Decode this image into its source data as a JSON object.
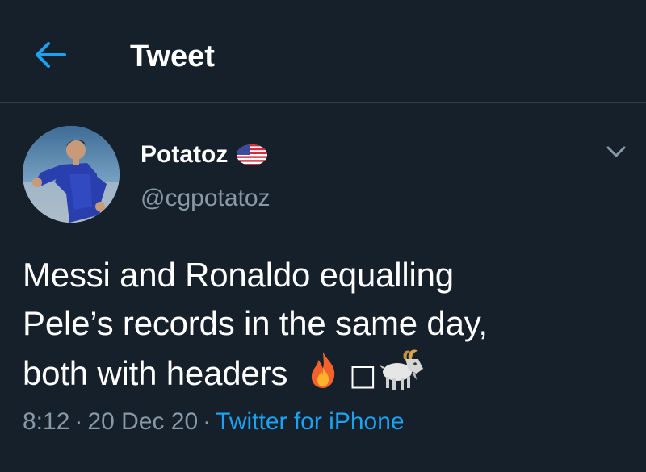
{
  "header": {
    "title": "Tweet",
    "back_icon": "arrow-left-icon",
    "accent_color": "#1da1f2"
  },
  "author": {
    "display_name": "Potatoz",
    "flag_icon": "us-flag-icon",
    "handle": "@cgpotatoz",
    "avatar_icon": "avatar-photo"
  },
  "tweet": {
    "lines": [
      "Messi and Ronaldo equalling",
      "Pele’s records in the same day,",
      "both with headers"
    ],
    "emojis": [
      "fire-emoji",
      "missing-glyph",
      "goat-emoji"
    ],
    "missing_glyph": "□"
  },
  "meta": {
    "time": "8:12",
    "sep1": "·",
    "date": "20 Dec 20",
    "sep2": "·",
    "source": "Twitter for iPhone"
  },
  "colors": {
    "background": "#15202b",
    "secondary_text": "#8899a6",
    "divider": "#2f3d4a"
  }
}
